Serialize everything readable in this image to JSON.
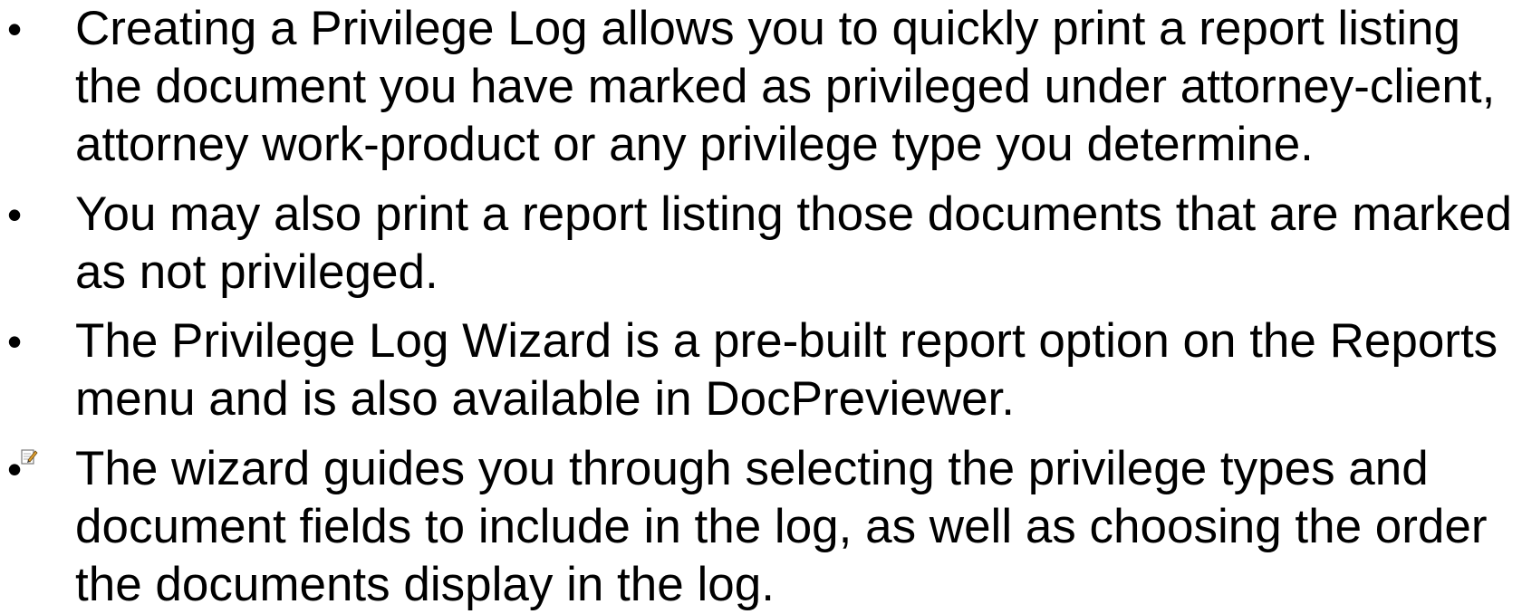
{
  "bullets": [
    {
      "symbol": "•",
      "lines": [
        "Creating a Privilege Log allows you to quickly print a report listing",
        "the document you have marked as privileged under attorney-client,",
        "attorney work-product or any privilege type you determine."
      ]
    },
    {
      "symbol": "•",
      "lines": [
        "You may also print a report listing those documents that are marked",
        "as not privileged."
      ]
    },
    {
      "symbol": "•",
      "lines": [
        "The Privilege Log Wizard is a pre-built report option on the Reports",
        "menu and is also available in DocPreviewer."
      ]
    },
    {
      "symbol": "•",
      "icon": "edit-note-icon",
      "lines": [
        "The wizard guides you through selecting the privilege types and",
        "document fields to include in the log, as well as choosing the order",
        "the documents display in the log."
      ]
    }
  ]
}
